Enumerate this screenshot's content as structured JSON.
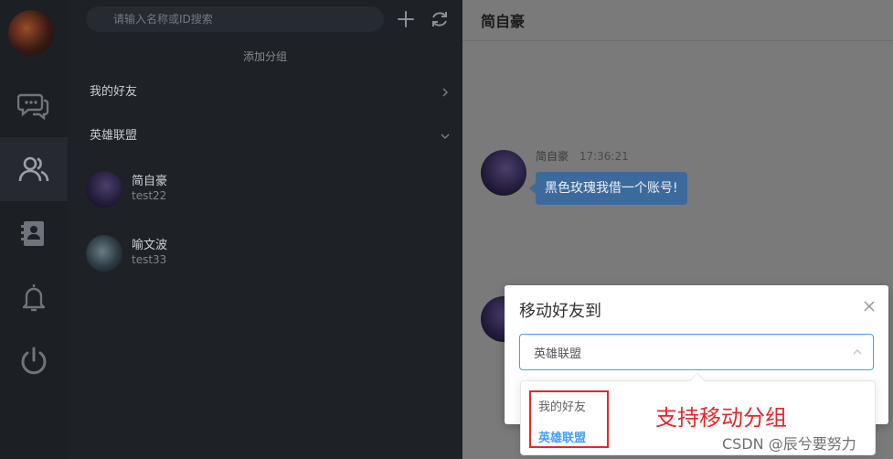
{
  "search": {
    "placeholder": "请输入名称或ID搜索"
  },
  "list": {
    "add_group_label": "添加分组",
    "groups": [
      {
        "label": "我的好友"
      },
      {
        "label": "英雄联盟"
      }
    ],
    "friends": [
      {
        "name": "简自豪",
        "id": "test22"
      },
      {
        "name": "喻文波",
        "id": "test33"
      }
    ]
  },
  "chat": {
    "title": "简自豪",
    "message": {
      "sender": "简自豪",
      "time": "17:36:21",
      "text": "黑色玫瑰我借一个账号!"
    }
  },
  "dialog": {
    "title": "移动好友到",
    "selected": "英雄联盟",
    "options": [
      "我的好友",
      "英雄联盟"
    ],
    "annotation": "支持移动分组"
  },
  "watermark": "CSDN @辰兮要努力",
  "colors": {
    "accent": "#409eff",
    "annotation": "#e8262a",
    "bubble": "#3d6a9d"
  },
  "icons": [
    "chat-icon",
    "contacts-icon",
    "address-book-icon",
    "bell-icon",
    "power-icon",
    "plus-icon",
    "refresh-icon",
    "close-icon"
  ]
}
